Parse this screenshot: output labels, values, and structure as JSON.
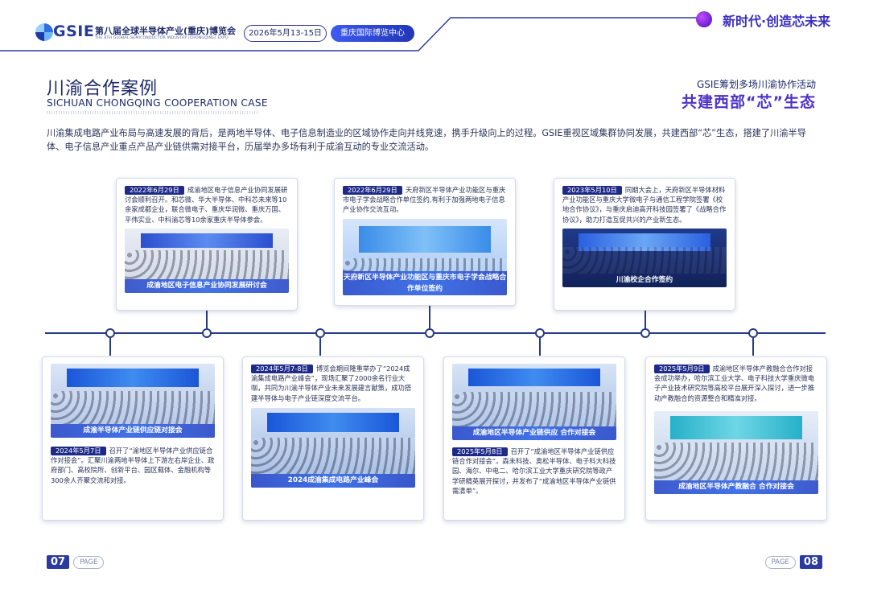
{
  "header": {
    "logo_text": "GSIE",
    "expo_name_cn": "第八届全球半导体产业(重庆)博览会",
    "expo_name_en": "THE 8TH GLOBAL SEMICONDUCTOR INDUSTRY (CHONGQING) EXPO",
    "date": "2026年5月13-15日",
    "venue": "重庆国际博览中心",
    "slogan": "新时代·创造芯未来"
  },
  "section": {
    "title_cn": "川渝合作案例",
    "title_en": "SICHUAN CHONGQING COOPERATION CASE",
    "tagline_1": "GSIE筹划多场川渝协作活动",
    "tagline_2": "共建西部“芯”生态"
  },
  "intro": "川渝集成电路产业布局与高速发展的背后，是两地半导体、电子信息制造业的区域协作走向并线竞速，携手升级向上的过程。GSIE重视区域集群协同发展，共建西部“芯”生态，搭建了川渝半导体、电子信息产业重点产品产业链供需对接平台，历届举办多场有利于成渝互动的专业交流活动。",
  "cards_top": [
    {
      "date": "2022年6月29日",
      "text": "成渝地区电子信息产业协同发展研讨会顺利召开。和芯微、华大半导体、中科芯未来等10余家成都企业，联合微电子、重庆华润微、重庆万国、平伟实业、中科渝芯等10余家重庆半导体参会。",
      "caption": "成渝地区电子信息产业协同发展研讨会"
    },
    {
      "date": "2022年6月29日",
      "text": "天府新区半导体产业功能区与重庆市电子学会战略合作单位签约,有利于加强两地电子信息产业协作交流互动。",
      "caption": "天府新区半导体产业功能区与重庆市电子学会战略合作单位签约"
    },
    {
      "date": "2023年5月10日",
      "text": "同期大会上，天府新区半导体材料产业功能区与重庆大学微电子与通信工程学院签署《校地合作协议》，与重庆启迪高开科技园签署了《战略合作协议》，助力打造互促共兴的产业新生态。",
      "caption": "川渝校企合作签约"
    }
  ],
  "cards_bottom": [
    {
      "date": "2024年5月7日",
      "text": "召开了“渝地区半导体产业供应链合作对接会”。汇聚川渝两地半导体上下游左右岸企业、政府部门、高校院所、创新平台、园区载体、金融机构等300余人齐聚交流和对接。",
      "caption": "成渝半导体产业链供应链对接会"
    },
    {
      "date": "2024年5月7-8日",
      "text": "博览会期间隆重举办了“2024成渝集成电路产业峰会”，现场汇聚了2000余名行业大咖，共同为川渝半导体产业未来发展建言献策，成功搭建半导体与电子产业链深度交流平台。",
      "caption": "2024成渝集成电路产业峰会"
    },
    {
      "date": "2025年5月8日",
      "text": "召开了“成渝地区半导体产业链供应链合作对接会”。森未科技、奥松半导体、电子科大科技园、海尔、中电二、哈尔滨工业大学重庆研究院等政产学研精英展开探讨，并发布了“成渝地区半导体产业链供需清单”。",
      "caption": "成渝地区半导体产业链供应 合作对接会"
    },
    {
      "date": "2025年5月9日",
      "text": "成渝地区半导体产教融合合作对接会成功举办，哈尔滨工业大学、电子科技大学重庆微电子产业技术研究院等高校平台展开深入探讨，进一步推动产教融合的资源整合和精准对接。",
      "caption": "成渝地区半导体产教融合 合作对接会"
    }
  ],
  "footer": {
    "left_num": "07",
    "left_label": "PAGE",
    "right_label": "PAGE",
    "right_num": "08"
  }
}
